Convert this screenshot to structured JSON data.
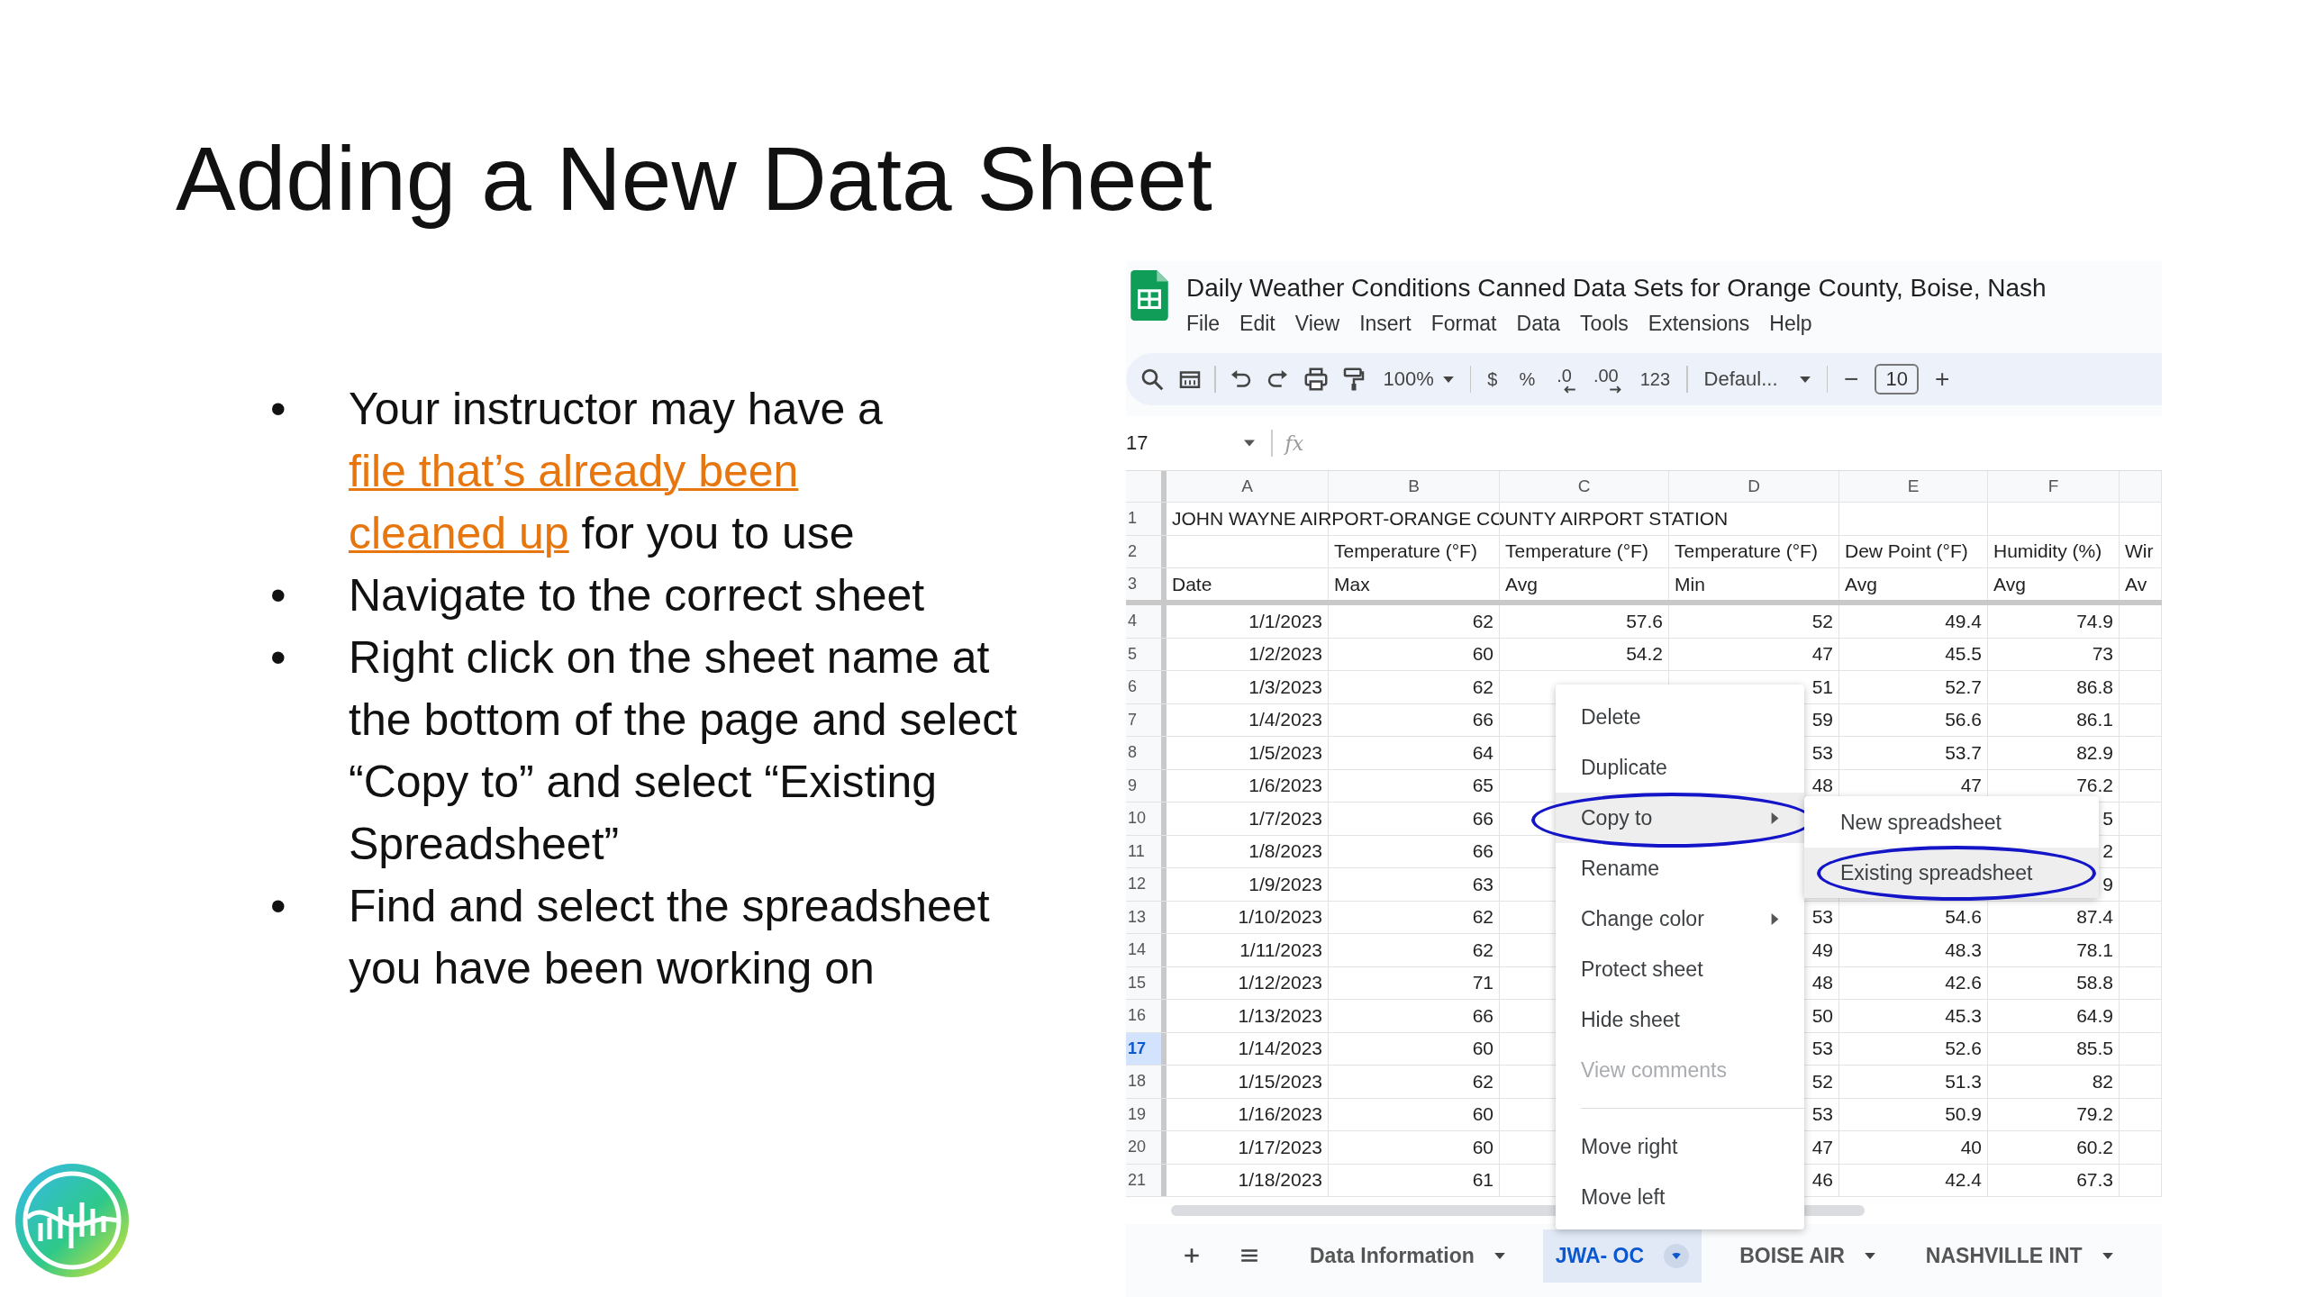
{
  "slide": {
    "title": "Adding a New Data Sheet",
    "bullets": [
      {
        "marker": "•",
        "parts": [
          {
            "kind": "text",
            "text": "Your instructor may have a "
          },
          {
            "kind": "link",
            "text": "file that’s already been",
            "line_break": true
          },
          {
            "kind": "link",
            "text": "cleaned up"
          },
          {
            "kind": "text",
            "text": " for you to use"
          }
        ]
      },
      {
        "marker": "•",
        "parts": [
          {
            "kind": "text",
            "text": "Navigate to the correct sheet"
          }
        ]
      },
      {
        "marker": "•",
        "parts": [
          {
            "kind": "text",
            "text": "Right click on the sheet name at the bottom of the page and select “Copy to” and select “Existing Spreadsheet”"
          }
        ]
      },
      {
        "marker": "•",
        "parts": [
          {
            "kind": "text",
            "text": "Find and select the spreadsheet you have been working on"
          }
        ]
      }
    ]
  },
  "spreadsheet": {
    "title": "Daily Weather Conditions Canned Data Sets for Orange County, Boise, Nash",
    "menus": [
      "File",
      "Edit",
      "View",
      "Insert",
      "Format",
      "Data",
      "Tools",
      "Extensions",
      "Help"
    ],
    "toolbar": {
      "zoom": "100%",
      "currency": "$",
      "percent": "%",
      "decrease_decimal": ".0",
      "increase_decimal": ".00",
      "number_format": "123",
      "font": "Defaul...",
      "minus": "−",
      "font_size": "10",
      "plus": "+"
    },
    "name_box": "17",
    "formula_label": "fx",
    "columns": [
      "A",
      "B",
      "C",
      "D",
      "E",
      "F"
    ],
    "rows": [
      {
        "number": "1",
        "kind": "label",
        "selected": false,
        "cells": [
          "JOHN WAYNE AIRPORT-ORANGE COUNTY AIRPORT STATION",
          null,
          null,
          null,
          null,
          null,
          null
        ]
      },
      {
        "number": "2",
        "kind": "label",
        "selected": false,
        "cells": [
          null,
          "Temperature (°F)",
          "Temperature (°F)",
          "Temperature (°F)",
          "Dew Point (°F)",
          "Humidity (%)",
          "Wir"
        ]
      },
      {
        "number": "3",
        "kind": "label",
        "selected": false,
        "cells": [
          "Date",
          "Max",
          "Avg",
          "Min",
          "Avg",
          "Avg",
          "Av"
        ]
      },
      {
        "number": "4",
        "kind": "data",
        "selected": false,
        "cells": [
          "1/1/2023",
          "62",
          "57.6",
          "52",
          "49.4",
          "74.9",
          null
        ]
      },
      {
        "number": "5",
        "kind": "data",
        "selected": false,
        "cells": [
          "1/2/2023",
          "60",
          "54.2",
          "47",
          "45.5",
          "73",
          null
        ]
      },
      {
        "number": "6",
        "kind": "data",
        "selected": false,
        "cells": [
          "1/3/2023",
          "62",
          null,
          "51",
          "52.7",
          "86.8",
          null
        ]
      },
      {
        "number": "7",
        "kind": "data",
        "selected": false,
        "cells": [
          "1/4/2023",
          "66",
          null,
          "59",
          "56.6",
          "86.1",
          null
        ]
      },
      {
        "number": "8",
        "kind": "data",
        "selected": false,
        "cells": [
          "1/5/2023",
          "64",
          null,
          "53",
          "53.7",
          "82.9",
          null
        ]
      },
      {
        "number": "9",
        "kind": "data",
        "selected": false,
        "cells": [
          "1/6/2023",
          "65",
          null,
          "48",
          "47",
          "76.2",
          null
        ]
      },
      {
        "number": "10",
        "kind": "data",
        "selected": false,
        "cells": [
          "1/7/2023",
          "66",
          null,
          null,
          null,
          "5",
          null
        ]
      },
      {
        "number": "11",
        "kind": "data",
        "selected": false,
        "cells": [
          "1/8/2023",
          "66",
          null,
          null,
          null,
          "2",
          null
        ]
      },
      {
        "number": "12",
        "kind": "data",
        "selected": false,
        "cells": [
          "1/9/2023",
          "63",
          null,
          null,
          null,
          "9",
          null
        ]
      },
      {
        "number": "13",
        "kind": "data",
        "selected": false,
        "cells": [
          "1/10/2023",
          "62",
          null,
          "53",
          "54.6",
          "87.4",
          null
        ]
      },
      {
        "number": "14",
        "kind": "data",
        "selected": false,
        "cells": [
          "1/11/2023",
          "62",
          null,
          "49",
          "48.3",
          "78.1",
          null
        ]
      },
      {
        "number": "15",
        "kind": "data",
        "selected": false,
        "cells": [
          "1/12/2023",
          "71",
          null,
          "48",
          "42.6",
          "58.8",
          null
        ]
      },
      {
        "number": "16",
        "kind": "data",
        "selected": false,
        "cells": [
          "1/13/2023",
          "66",
          null,
          "50",
          "45.3",
          "64.9",
          null
        ]
      },
      {
        "number": "17",
        "kind": "data",
        "selected": true,
        "cells": [
          "1/14/2023",
          "60",
          null,
          "53",
          "52.6",
          "85.5",
          null
        ]
      },
      {
        "number": "18",
        "kind": "data",
        "selected": false,
        "cells": [
          "1/15/2023",
          "62",
          null,
          "52",
          "51.3",
          "82",
          null
        ]
      },
      {
        "number": "19",
        "kind": "data",
        "selected": false,
        "cells": [
          "1/16/2023",
          "60",
          null,
          "53",
          "50.9",
          "79.2",
          null
        ]
      },
      {
        "number": "20",
        "kind": "data",
        "selected": false,
        "cells": [
          "1/17/2023",
          "60",
          null,
          "47",
          "40",
          "60.2",
          null
        ]
      },
      {
        "number": "21",
        "kind": "data",
        "selected": false,
        "cells": [
          "1/18/2023",
          "61",
          null,
          "46",
          "42.4",
          "67.3",
          null
        ]
      }
    ],
    "context_menu": [
      {
        "kind": "item",
        "label": "Delete",
        "disabled": false,
        "selected": false,
        "submenu": false,
        "circled": false
      },
      {
        "kind": "item",
        "label": "Duplicate",
        "disabled": false,
        "selected": false,
        "submenu": false,
        "circled": false
      },
      {
        "kind": "item",
        "label": "Copy to",
        "disabled": false,
        "selected": true,
        "submenu": true,
        "circled": true
      },
      {
        "kind": "item",
        "label": "Rename",
        "disabled": false,
        "selected": false,
        "submenu": false,
        "circled": false
      },
      {
        "kind": "item",
        "label": "Change color",
        "disabled": false,
        "selected": false,
        "submenu": true,
        "circled": false
      },
      {
        "kind": "item",
        "label": "Protect sheet",
        "disabled": false,
        "selected": false,
        "submenu": false,
        "circled": false
      },
      {
        "kind": "item",
        "label": "Hide sheet",
        "disabled": false,
        "selected": false,
        "submenu": false,
        "circled": false
      },
      {
        "kind": "item",
        "label": "View comments",
        "disabled": true,
        "selected": false,
        "submenu": false,
        "circled": false
      },
      {
        "kind": "divider"
      },
      {
        "kind": "item",
        "label": "Move right",
        "disabled": false,
        "selected": false,
        "submenu": false,
        "circled": false
      },
      {
        "kind": "item",
        "label": "Move left",
        "disabled": false,
        "selected": false,
        "submenu": false,
        "circled": false
      }
    ],
    "submenu": [
      {
        "label": "New spreadsheet",
        "selected": false,
        "circled": false
      },
      {
        "label": "Existing spreadsheet",
        "selected": true,
        "circled": true
      }
    ],
    "sheet_tabs": [
      {
        "label": "Data Information",
        "selected": false
      },
      {
        "label": "JWA- OC",
        "selected": true
      },
      {
        "label": "BOISE AIR",
        "selected": false
      },
      {
        "label": "NASHVILLE INT",
        "selected": false
      }
    ]
  }
}
